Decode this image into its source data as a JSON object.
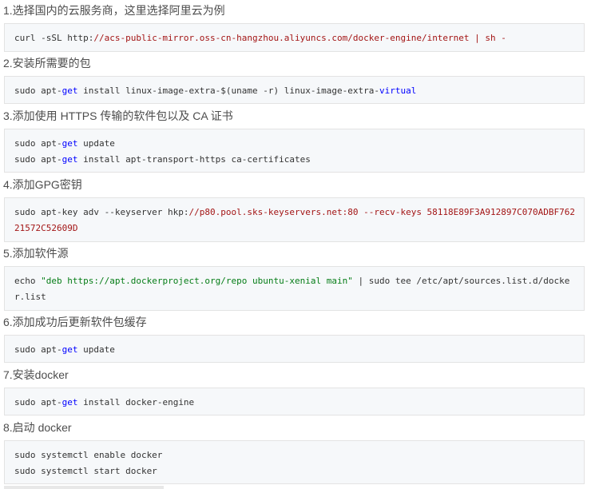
{
  "steps": [
    {
      "title": "1.选择国内的云服务商，这里选择阿里云为例"
    },
    {
      "title": "2.安装所需要的包"
    },
    {
      "title": "3.添加使用 HTTPS 传输的软件包以及 CA 证书"
    },
    {
      "title": "4.添加GPG密钥"
    },
    {
      "title": "5.添加软件源"
    },
    {
      "title": "6.添加成功后更新软件包缓存"
    },
    {
      "title": "7.安装docker"
    },
    {
      "title": "8.启动 docker"
    }
  ],
  "code": {
    "s1": {
      "a": "curl -sSL http:",
      "b": "//acs-public-mirror.oss-cn-hangzhou.aliyuncs.com/docker-engine/internet | sh -"
    },
    "s2": {
      "a": "sudo apt-",
      "b": "get",
      "c": " install linux-image-extra-$(uname -r) linux-image-extra-",
      "d": "virtual"
    },
    "s3": {
      "l1": {
        "a": "sudo apt-",
        "b": "get",
        "c": " update"
      },
      "l2": {
        "a": "sudo apt-",
        "b": "get",
        "c": " install apt-transport-https ca-certificates"
      }
    },
    "s4": {
      "l1": {
        "a": "sudo apt-key adv --keyserver hkp:",
        "b": "//p80.pool.sks-keyservers.net:80 --recv-keys 58118E89F3A912897C070ADBF762"
      },
      "l2": {
        "a": "21572C52609D"
      }
    },
    "s5": {
      "l1": {
        "a": "echo ",
        "b": "\"deb https://apt.dockerproject.org/repo ubuntu-xenial main\"",
        "c": " | sudo tee /etc/apt/sources.list.d/docke"
      },
      "l2": {
        "a": "r.list"
      }
    },
    "s6": {
      "a": "sudo apt-",
      "b": "get",
      "c": " update"
    },
    "s7": {
      "a": "sudo apt-",
      "b": "get",
      "c": " install docker-engine"
    },
    "s8": {
      "l1": "sudo systemctl enable docker",
      "l2": "sudo systemctl start docker"
    }
  }
}
